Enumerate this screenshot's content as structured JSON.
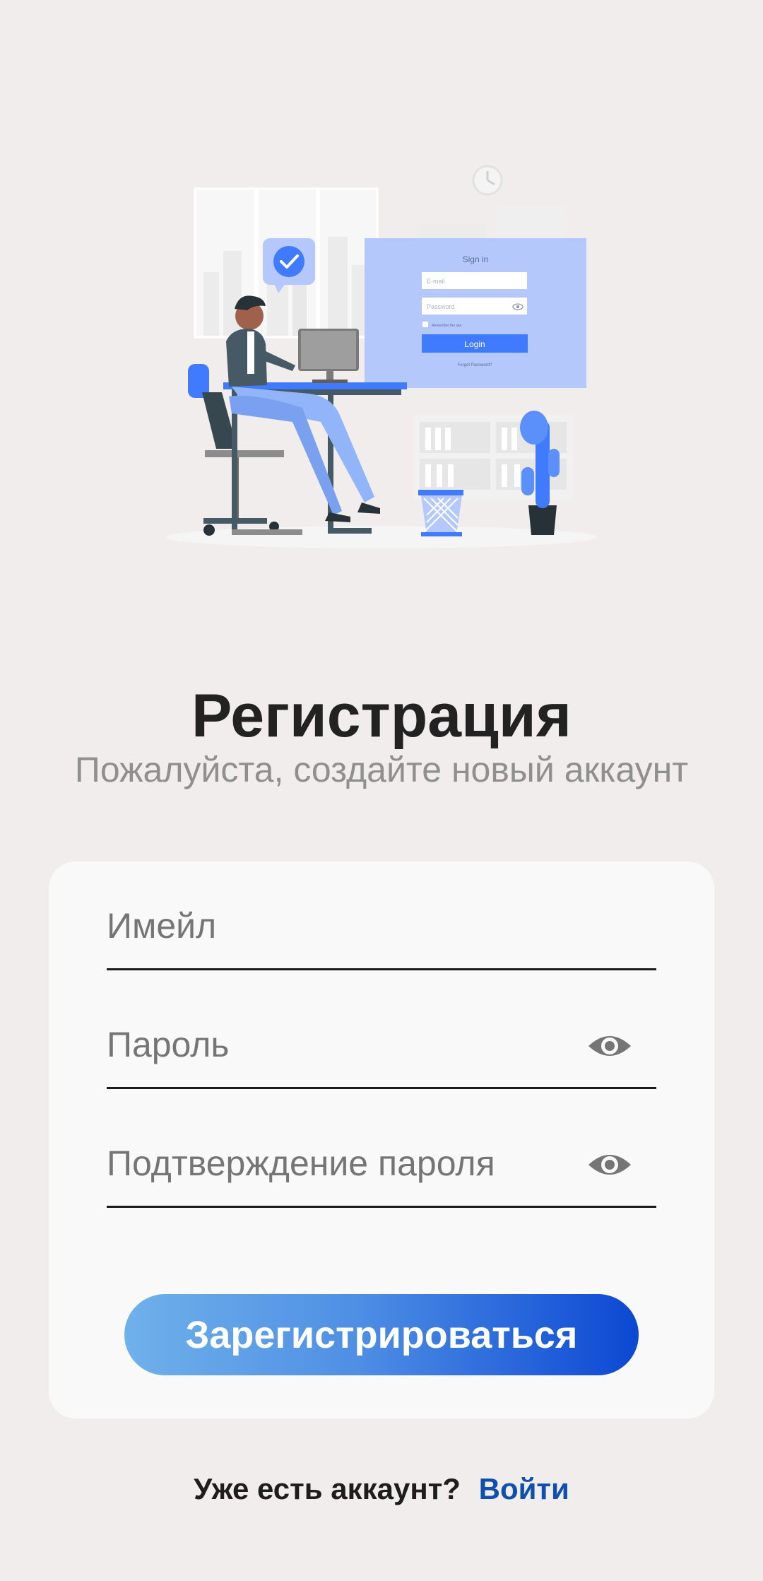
{
  "illustration": {
    "sign_in_title": "Sign in",
    "email_placeholder": "E-mail",
    "password_placeholder": "Password",
    "remember_text": "Remember the site",
    "login_label": "Login",
    "forgot_text": "Forgot Password?"
  },
  "header": {
    "title": "Регистрация",
    "subtitle": "Пожалуйста, создайте новый аккаунт"
  },
  "form": {
    "email_placeholder": "Имейл",
    "password_placeholder": "Пароль",
    "confirm_placeholder": "Подтверждение пароля",
    "submit_label": "Зарегистрироваться",
    "eye_icon": "eye-icon"
  },
  "footer": {
    "question": "Уже есть аккаунт?",
    "login_link": "Войти"
  },
  "colors": {
    "background": "#f0edec",
    "card": "#f9f9f9",
    "accent_start": "#6fb1ea",
    "accent_end": "#0b48d3",
    "link": "#0f4fae",
    "illustration_blue": "#407bff"
  }
}
